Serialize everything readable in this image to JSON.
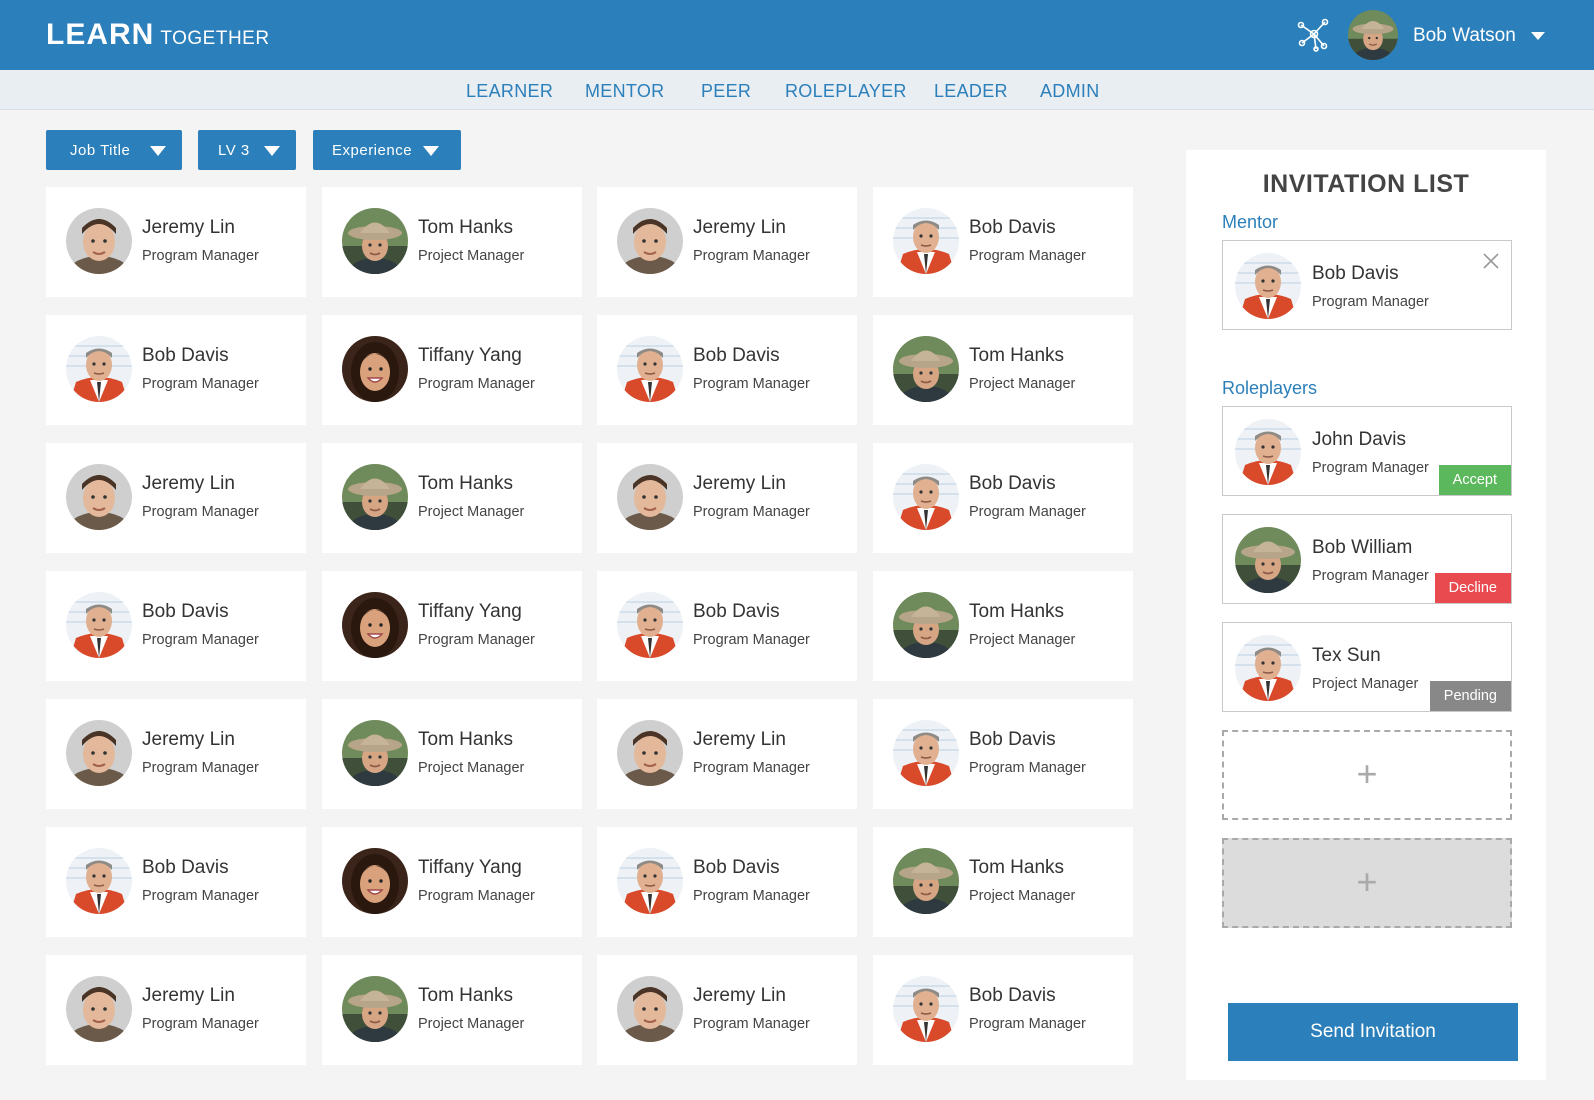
{
  "app": {
    "brand_main": "LEARN",
    "brand_sub": "TOGETHER"
  },
  "user": {
    "name": "Bob Watson"
  },
  "nav": [
    {
      "label": "LEARNER"
    },
    {
      "label": "MENTOR"
    },
    {
      "label": "PEER"
    },
    {
      "label": "ROLEPLAYER"
    },
    {
      "label": "LEADER"
    },
    {
      "label": "ADMIN"
    }
  ],
  "filters": [
    {
      "label": "Job Title"
    },
    {
      "label": "LV 3"
    },
    {
      "label": "Experience"
    }
  ],
  "people": [
    {
      "name": "Jeremy Lin",
      "role": "Program Manager",
      "avatar": "jeremy"
    },
    {
      "name": "Tom Hanks",
      "role": "Project Manager",
      "avatar": "tom"
    },
    {
      "name": "Jeremy Lin",
      "role": "Program Manager",
      "avatar": "jeremy"
    },
    {
      "name": "Bob Davis",
      "role": "Program Manager",
      "avatar": "bob"
    },
    {
      "name": "Bob Davis",
      "role": "Program Manager",
      "avatar": "bob"
    },
    {
      "name": "Tiffany Yang",
      "role": "Program Manager",
      "avatar": "tiffany"
    },
    {
      "name": "Bob Davis",
      "role": "Program Manager",
      "avatar": "bob"
    },
    {
      "name": "Tom Hanks",
      "role": "Project Manager",
      "avatar": "tom"
    },
    {
      "name": "Jeremy Lin",
      "role": "Program Manager",
      "avatar": "jeremy"
    },
    {
      "name": "Tom Hanks",
      "role": "Project Manager",
      "avatar": "tom"
    },
    {
      "name": "Jeremy Lin",
      "role": "Program Manager",
      "avatar": "jeremy"
    },
    {
      "name": "Bob Davis",
      "role": "Program Manager",
      "avatar": "bob"
    },
    {
      "name": "Bob Davis",
      "role": "Program Manager",
      "avatar": "bob"
    },
    {
      "name": "Tiffany Yang",
      "role": "Program Manager",
      "avatar": "tiffany"
    },
    {
      "name": "Bob Davis",
      "role": "Program Manager",
      "avatar": "bob"
    },
    {
      "name": "Tom Hanks",
      "role": "Project Manager",
      "avatar": "tom"
    },
    {
      "name": "Jeremy Lin",
      "role": "Program Manager",
      "avatar": "jeremy"
    },
    {
      "name": "Tom Hanks",
      "role": "Project Manager",
      "avatar": "tom"
    },
    {
      "name": "Jeremy Lin",
      "role": "Program Manager",
      "avatar": "jeremy"
    },
    {
      "name": "Bob Davis",
      "role": "Program Manager",
      "avatar": "bob"
    },
    {
      "name": "Bob Davis",
      "role": "Program Manager",
      "avatar": "bob"
    },
    {
      "name": "Tiffany Yang",
      "role": "Program Manager",
      "avatar": "tiffany"
    },
    {
      "name": "Bob Davis",
      "role": "Program Manager",
      "avatar": "bob"
    },
    {
      "name": "Tom Hanks",
      "role": "Project Manager",
      "avatar": "tom"
    },
    {
      "name": "Jeremy Lin",
      "role": "Program Manager",
      "avatar": "jeremy"
    },
    {
      "name": "Tom Hanks",
      "role": "Project Manager",
      "avatar": "tom"
    },
    {
      "name": "Jeremy Lin",
      "role": "Program Manager",
      "avatar": "jeremy"
    },
    {
      "name": "Bob Davis",
      "role": "Program Manager",
      "avatar": "bob"
    }
  ],
  "invitation": {
    "title": "INVITATION LIST",
    "mentor_label": "Mentor",
    "mentor": {
      "name": "Bob Davis",
      "role": "Program Manager",
      "avatar": "bob"
    },
    "roleplayers_label": "Roleplayers",
    "roleplayers": [
      {
        "name": "John Davis",
        "role": "Program Manager",
        "avatar": "bob",
        "status": "Accept"
      },
      {
        "name": "Bob William",
        "role": "Program Manager",
        "avatar": "tom",
        "status": "Decline"
      },
      {
        "name": "Tex Sun",
        "role": "Project Manager",
        "avatar": "bob",
        "status": "Pending"
      }
    ],
    "add_symbol": "+",
    "send_label": "Send Invitation"
  },
  "colors": {
    "primary": "#2b7fba",
    "accept": "#5cb85c",
    "decline": "#e84a4f",
    "pending": "#888888"
  },
  "icons": {
    "network": "network-icon",
    "caret": "caret-down-icon",
    "close": "close-icon"
  }
}
